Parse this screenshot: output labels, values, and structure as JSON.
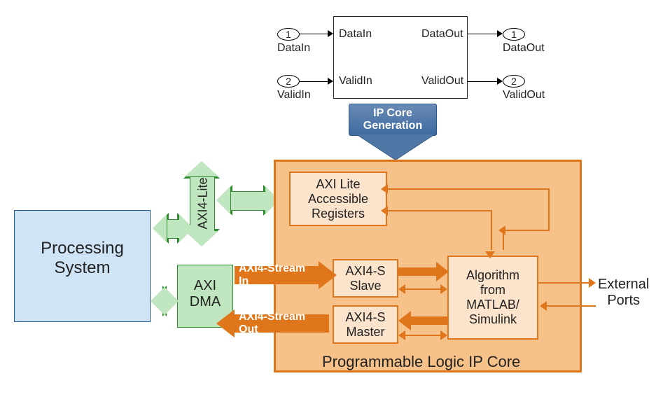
{
  "simulink": {
    "ports_in": [
      {
        "num": "1",
        "label": "DataIn",
        "signal": "DataIn"
      },
      {
        "num": "2",
        "label": "ValidIn",
        "signal": "ValidIn"
      }
    ],
    "ports_out": [
      {
        "num": "1",
        "label": "DataOut",
        "signal": "DataOut"
      },
      {
        "num": "2",
        "label": "ValidOut",
        "signal": "ValidOut"
      }
    ]
  },
  "step_arrow": {
    "line1": "IP Core",
    "line2": "Generation"
  },
  "ps": {
    "line1": "Processing",
    "line2": "System"
  },
  "bus": {
    "axi4_lite": "AXI4-Lite"
  },
  "dma": {
    "line1": "AXI",
    "line2": "DMA"
  },
  "ip_core": {
    "title": "Programmable Logic IP Core",
    "axi_regs": {
      "line1": "AXI Lite",
      "line2": "Accessible",
      "line3": "Registers"
    },
    "axi4s_slave": {
      "line1": "AXI4-S",
      "line2": "Slave"
    },
    "axi4s_master": {
      "line1": "AXI4-S",
      "line2": "Master"
    },
    "algorithm": {
      "line1": "Algorithm",
      "line2": "from",
      "line3": "MATLAB/",
      "line4": "Simulink"
    }
  },
  "stream_labels": {
    "in": "AXI4-Stream In",
    "out": "AXI4-Stream Out"
  },
  "external": {
    "line1": "External",
    "line2": "Ports"
  }
}
